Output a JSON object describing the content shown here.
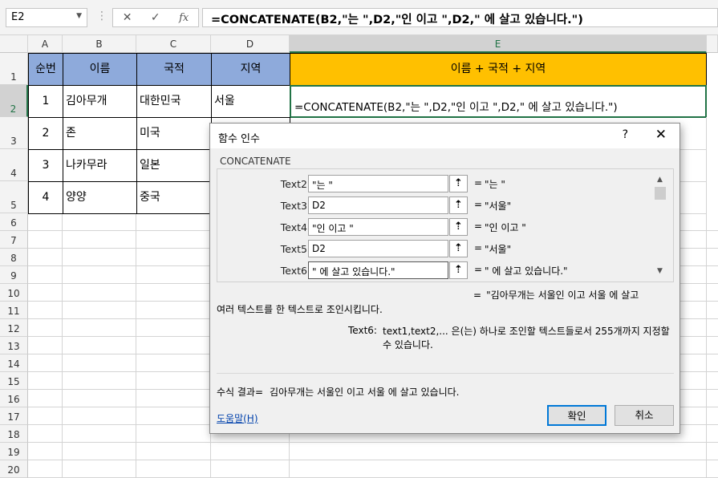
{
  "formula_bar": {
    "name_box": "E2",
    "fx": "fx",
    "formula": "=CONCATENATE(B2,\"는 \",D2,\"인 이고 \",D2,\" 에 살고 있습니다.\")"
  },
  "columns": [
    "A",
    "B",
    "C",
    "D",
    "E"
  ],
  "rows": [
    "1",
    "2",
    "3",
    "4",
    "5",
    "6",
    "7",
    "8",
    "9",
    "10",
    "11",
    "12",
    "13",
    "14",
    "15",
    "16",
    "17",
    "18",
    "19",
    "20"
  ],
  "table": {
    "headers": [
      "순번",
      "이름",
      "국적",
      "지역",
      "이름 + 국적 + 지역"
    ],
    "data": [
      [
        "1",
        "김아무개",
        "대한민국",
        "서울",
        "=CONCATENATE(B2,\"는 \",D2,\"인 이고 \",D2,\" 에 살고 있습니다.\")"
      ],
      [
        "2",
        "존",
        "미국",
        "",
        ""
      ],
      [
        "3",
        "나카무라",
        "일본",
        "",
        ""
      ],
      [
        "4",
        "양양",
        "중국",
        "",
        ""
      ]
    ]
  },
  "dialog": {
    "title": "함수 인수",
    "help_q": "?",
    "close": "✕",
    "function_name": "CONCATENATE",
    "args": [
      {
        "label": "Text2",
        "input": "\"는 \"",
        "value": "\"는 \""
      },
      {
        "label": "Text3",
        "input": "D2",
        "value": "\"서울\""
      },
      {
        "label": "Text4",
        "input": "\"인 이고 \"",
        "value": "\"인 이고 \""
      },
      {
        "label": "Text5",
        "input": "D2",
        "value": "\"서울\""
      },
      {
        "label": "Text6",
        "input": "\" 에 살고 있습니다.\"",
        "value": "\" 에 살고 있습니다.\""
      }
    ],
    "result_preview": "\"김아무개는 서울인 이고 서울 에 살고",
    "description": "여러 텍스트를 한 텍스트로 조인시킵니다.",
    "arg_desc_label": "Text6:",
    "arg_desc_text": "text1,text2,... 은(는) 하나로 조인할 텍스트들로서 255개까지 지정할 수 있습니다.",
    "formula_result_label": "수식 결과=",
    "formula_result_value": "김아무개는 서울인 이고 서울 에 살고 있습니다.",
    "help_link": "도움말(H)",
    "ok_label": "확인",
    "cancel_label": "취소"
  }
}
